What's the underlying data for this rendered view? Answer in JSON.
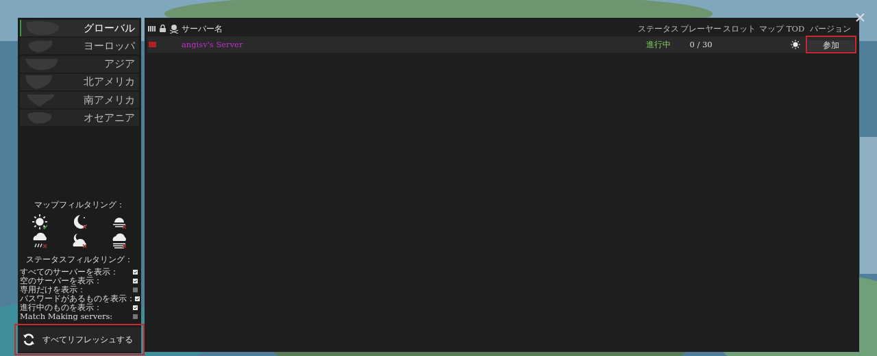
{
  "regions": [
    {
      "label": "グローバル",
      "selected": true
    },
    {
      "label": "ヨーロッパ",
      "selected": false
    },
    {
      "label": "アジア",
      "selected": false
    },
    {
      "label": "北アメリカ",
      "selected": false
    },
    {
      "label": "南アメリカ",
      "selected": false
    },
    {
      "label": "オセアニア",
      "selected": false
    }
  ],
  "map_filter": {
    "title": "マップフィルタリング：",
    "items": [
      {
        "kind": "sun",
        "checked": true
      },
      {
        "kind": "moon",
        "checked": false
      },
      {
        "kind": "sunset",
        "checked": false
      },
      {
        "kind": "rain",
        "checked": false
      },
      {
        "kind": "night-cloud",
        "checked": false
      },
      {
        "kind": "fog",
        "checked": false
      }
    ]
  },
  "status_filter": {
    "title": "ステータスフィルタリング：",
    "items": [
      {
        "label": "すべてのサーバーを表示：",
        "checked": true
      },
      {
        "label": "空のサーバーを表示：",
        "checked": true
      },
      {
        "label": "専用だけを表示：",
        "checked": false
      },
      {
        "label": "パスワードがあるものを表示：",
        "checked": true
      },
      {
        "label": "進行中のものを表示：",
        "checked": true
      },
      {
        "label": "Match Making servers:",
        "checked": false
      }
    ]
  },
  "refresh_button": {
    "label": "すべてリフレッシュする",
    "highlighted": true
  },
  "table": {
    "columns": [
      "サーバー名",
      "ステータス",
      "プレーヤー",
      "スロット",
      "マップ",
      "TOD",
      "バージョン"
    ],
    "rows": [
      {
        "name": "angisv's Server",
        "status": "進行中",
        "players": "0 / 30",
        "tod": {
          "kind": "sun"
        },
        "action": "参加",
        "highlighted": true
      }
    ]
  }
}
